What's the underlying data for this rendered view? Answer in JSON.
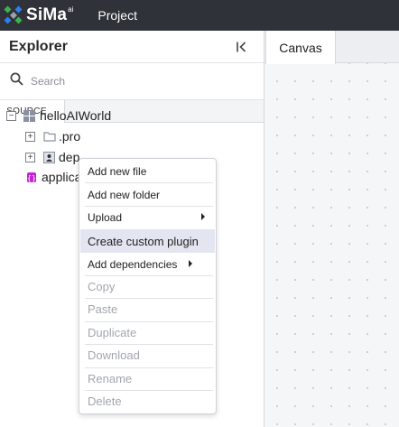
{
  "app": {
    "brand": "SiMa",
    "brand_sup": "ai",
    "project_label": "Project"
  },
  "explorer": {
    "title": "Explorer",
    "search_placeholder": "Search",
    "tab_source": "SOURCE"
  },
  "tree": {
    "root_label": "helloAIWorld",
    "items": [
      {
        "label": ".pro",
        "icon": "folder-icon"
      },
      {
        "label": "dep",
        "icon": "dependency-icon"
      },
      {
        "label": "applica",
        "icon": "application-icon"
      }
    ]
  },
  "canvas": {
    "tab_label": "Canvas"
  },
  "context_menu": {
    "items": [
      {
        "label": "Add new file",
        "enabled": true
      },
      {
        "label": "Add new folder",
        "enabled": true
      },
      {
        "label": "Upload",
        "enabled": true,
        "submenu": true
      },
      {
        "label": "Create custom plugin",
        "enabled": true,
        "highlighted": true
      },
      {
        "label": "Add dependencies",
        "enabled": true,
        "submenu": true
      },
      {
        "label": "Copy",
        "enabled": false
      },
      {
        "label": "Paste",
        "enabled": false
      },
      {
        "label": "Duplicate",
        "enabled": false
      },
      {
        "label": "Download",
        "enabled": false
      },
      {
        "label": "Rename",
        "enabled": false
      },
      {
        "label": "Delete",
        "enabled": false
      }
    ]
  },
  "colors": {
    "topbar_bg": "#2f3238",
    "logo_green": "#3bb54a",
    "logo_blue": "#2f80ed",
    "menu_highlight": "#e3e6f0",
    "app_icon": "#c026d3"
  }
}
